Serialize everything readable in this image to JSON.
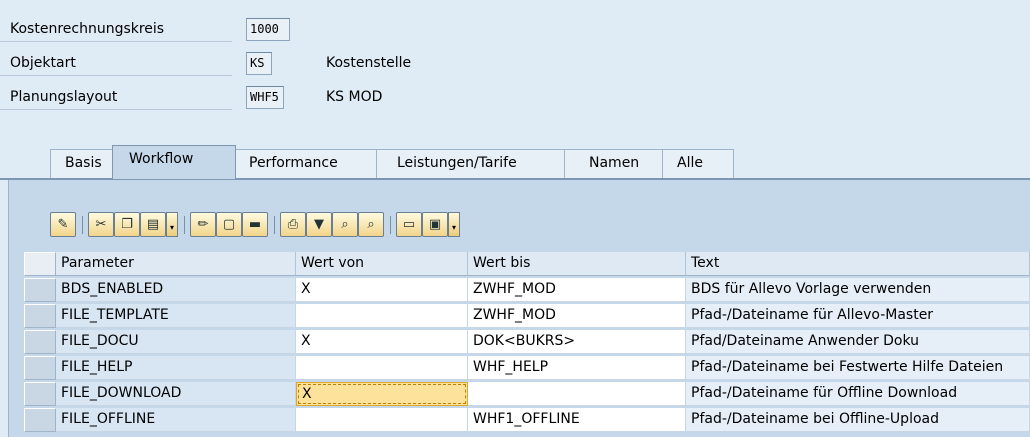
{
  "header": {
    "rows": [
      {
        "label": "Kostenrechnungskreis",
        "value": "1000",
        "desc": ""
      },
      {
        "label": "Objektart",
        "value": "KS",
        "desc": "Kostenstelle"
      },
      {
        "label": "Planungslayout",
        "value": "WHF5",
        "desc": "KS MOD"
      }
    ]
  },
  "tabs": [
    "Basis",
    "Workflow",
    "Performance",
    "Leistungen/Tarife",
    "Namen",
    "Alle"
  ],
  "active_tab": "Workflow",
  "toolbar": {
    "icons": [
      "details-icon",
      "cut-icon",
      "copy-icon",
      "paste-icon",
      "edit-icon",
      "new-icon",
      "delete-icon",
      "print-icon",
      "filter-icon",
      "find-icon",
      "find-next-icon",
      "layout-icon",
      "export-icon"
    ]
  },
  "table": {
    "columns": [
      "Parameter",
      "Wert von",
      "Wert bis",
      "Text"
    ],
    "rows": [
      [
        "BDS_ENABLED",
        "X",
        "ZWHF_MOD",
        "BDS für Allevo Vorlage verwenden"
      ],
      [
        "FILE_TEMPLATE",
        "",
        "ZWHF_MOD",
        "Pfad-/Dateiname für Allevo-Master"
      ],
      [
        "FILE_DOCU",
        "X",
        "DOK<BUKRS>",
        "Pfad/Dateiname Anwender Doku"
      ],
      [
        "FILE_HELP",
        "",
        "WHF_HELP",
        "Pfad-/Dateiname bei Festwerte Hilfe Dateien"
      ],
      [
        "FILE_DOWNLOAD",
        "X",
        "",
        "Pfad-/Dateiname für Offline Download"
      ],
      [
        "FILE_OFFLINE",
        "",
        "WHF1_OFFLINE",
        "Pfad-/Dateiname bei Offline-Upload"
      ]
    ]
  },
  "colors": {
    "background": "#dfebf5",
    "panel": "#c5d8ea",
    "focus_cell": "#fde29b",
    "toolbar_button": "#f2d48a"
  }
}
